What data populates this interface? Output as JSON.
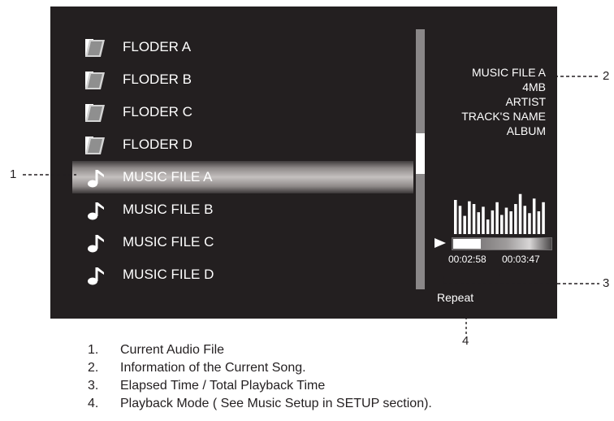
{
  "colors": {
    "screen_bg": "#231f20",
    "text": "#ffffff",
    "scrollbar": "#8a8788",
    "callout": "#231f20"
  },
  "file_list": {
    "items": [
      {
        "label": "FLODER A",
        "icon": "folder-icon",
        "selected": false
      },
      {
        "label": "FLODER B",
        "icon": "folder-icon",
        "selected": false
      },
      {
        "label": "FLODER C",
        "icon": "folder-icon",
        "selected": false
      },
      {
        "label": "FLODER D",
        "icon": "folder-icon",
        "selected": false
      },
      {
        "label": "MUSIC FILE A",
        "icon": "music-note-icon",
        "selected": true
      },
      {
        "label": "MUSIC FILE B",
        "icon": "music-note-icon",
        "selected": false
      },
      {
        "label": "MUSIC FILE C",
        "icon": "music-note-icon",
        "selected": false
      },
      {
        "label": "MUSIC FILE D",
        "icon": "music-note-icon",
        "selected": false
      }
    ]
  },
  "song_info": {
    "file_name": "MUSIC FILE A",
    "size": "4MB",
    "artist": "ARTIST",
    "track_name": "TRACK'S NAME",
    "album": "ALBUM"
  },
  "playback": {
    "play_icon": "play-icon",
    "elapsed": "00:02:58",
    "total": "00:03:47",
    "progress_fraction": 0.28,
    "mode": "Repeat"
  },
  "spectrum_levels": [
    0.75,
    0.62,
    0.4,
    0.72,
    0.66,
    0.48,
    0.6,
    0.32,
    0.52,
    0.7,
    0.42,
    0.58,
    0.5,
    0.66,
    0.88,
    0.62,
    0.46,
    0.78,
    0.5,
    0.7
  ],
  "callouts": {
    "c1": "1",
    "c2": "2",
    "c3": "3",
    "c4": "4"
  },
  "legend": [
    {
      "num": "1.",
      "text": "Current Audio File"
    },
    {
      "num": "2.",
      "text": "Information of the Current Song."
    },
    {
      "num": "3.",
      "text": "Elapsed Time / Total Playback Time"
    },
    {
      "num": "4.",
      "text": "Playback Mode ( See Music Setup in SETUP section)."
    }
  ]
}
